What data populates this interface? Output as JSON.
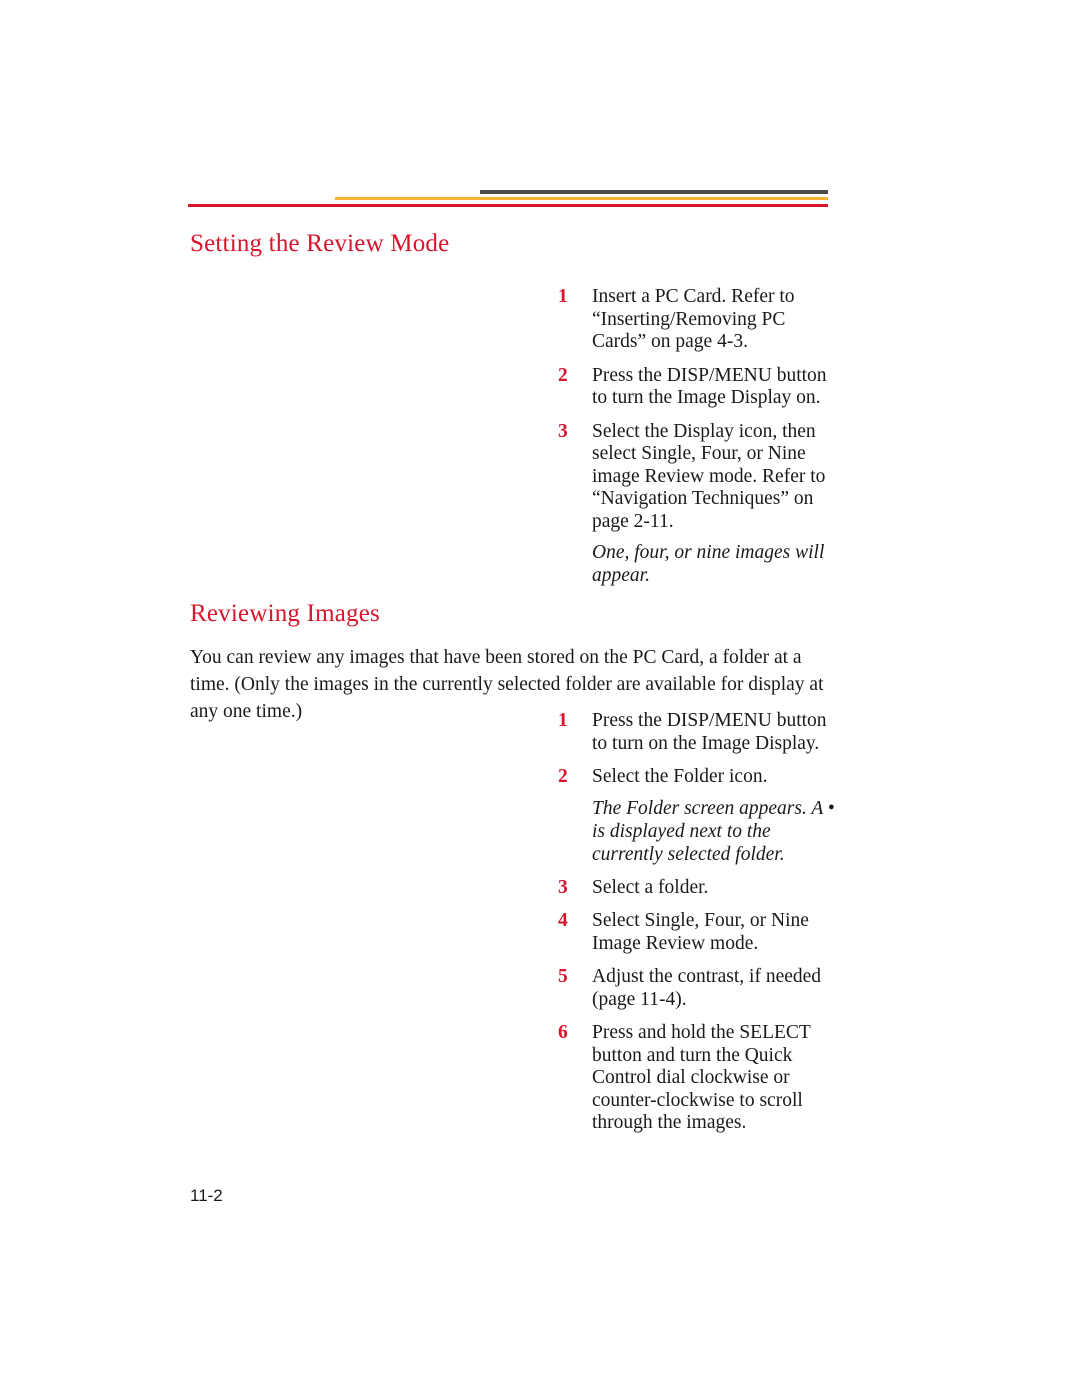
{
  "document": {
    "folio": "11-2"
  },
  "header_rules": {
    "dark_color": "#4d4d4d",
    "orange_color": "#f9b233",
    "red_color": "#d8152c"
  },
  "sections": [
    {
      "heading": "Setting the Review Mode",
      "steps": [
        {
          "number": "1",
          "text": "Insert a PC Card. Refer to “Inserting/Removing PC Cards” on page 4-3.",
          "note": ""
        },
        {
          "number": "2",
          "text": "Press the DISP/MENU button to turn the Image Display on.",
          "note": ""
        },
        {
          "number": "3",
          "text": "Select the Display icon, then select Single, Four, or Nine image Review mode. Refer to “Navigation Techniques” on page 2-11.",
          "note": "One, four, or nine images will appear."
        }
      ]
    },
    {
      "heading": "Reviewing Images",
      "intro": "You can review any images that have been stored on the PC Card, a folder at a time. (Only the images in the currently selected folder are available for display at any one time.)",
      "steps": [
        {
          "number": "1",
          "text": "Press the DISP/MENU button to turn on the Image Display.",
          "note": ""
        },
        {
          "number": "2",
          "text": "Select the Folder icon.",
          "note": "The Folder screen appears. A • is displayed next to the currently selected folder."
        },
        {
          "number": "3",
          "text": "Select a folder.",
          "note": ""
        },
        {
          "number": "4",
          "text": "Select Single, Four, or Nine Image Review mode.",
          "note": ""
        },
        {
          "number": "5",
          "text": "Adjust the contrast, if needed (page 11-4).",
          "note": ""
        },
        {
          "number": "6",
          "text": "Press and hold the SELECT button and turn the Quick Control dial clockwise or counter-clockwise to scroll through the images.",
          "note": ""
        }
      ]
    }
  ]
}
